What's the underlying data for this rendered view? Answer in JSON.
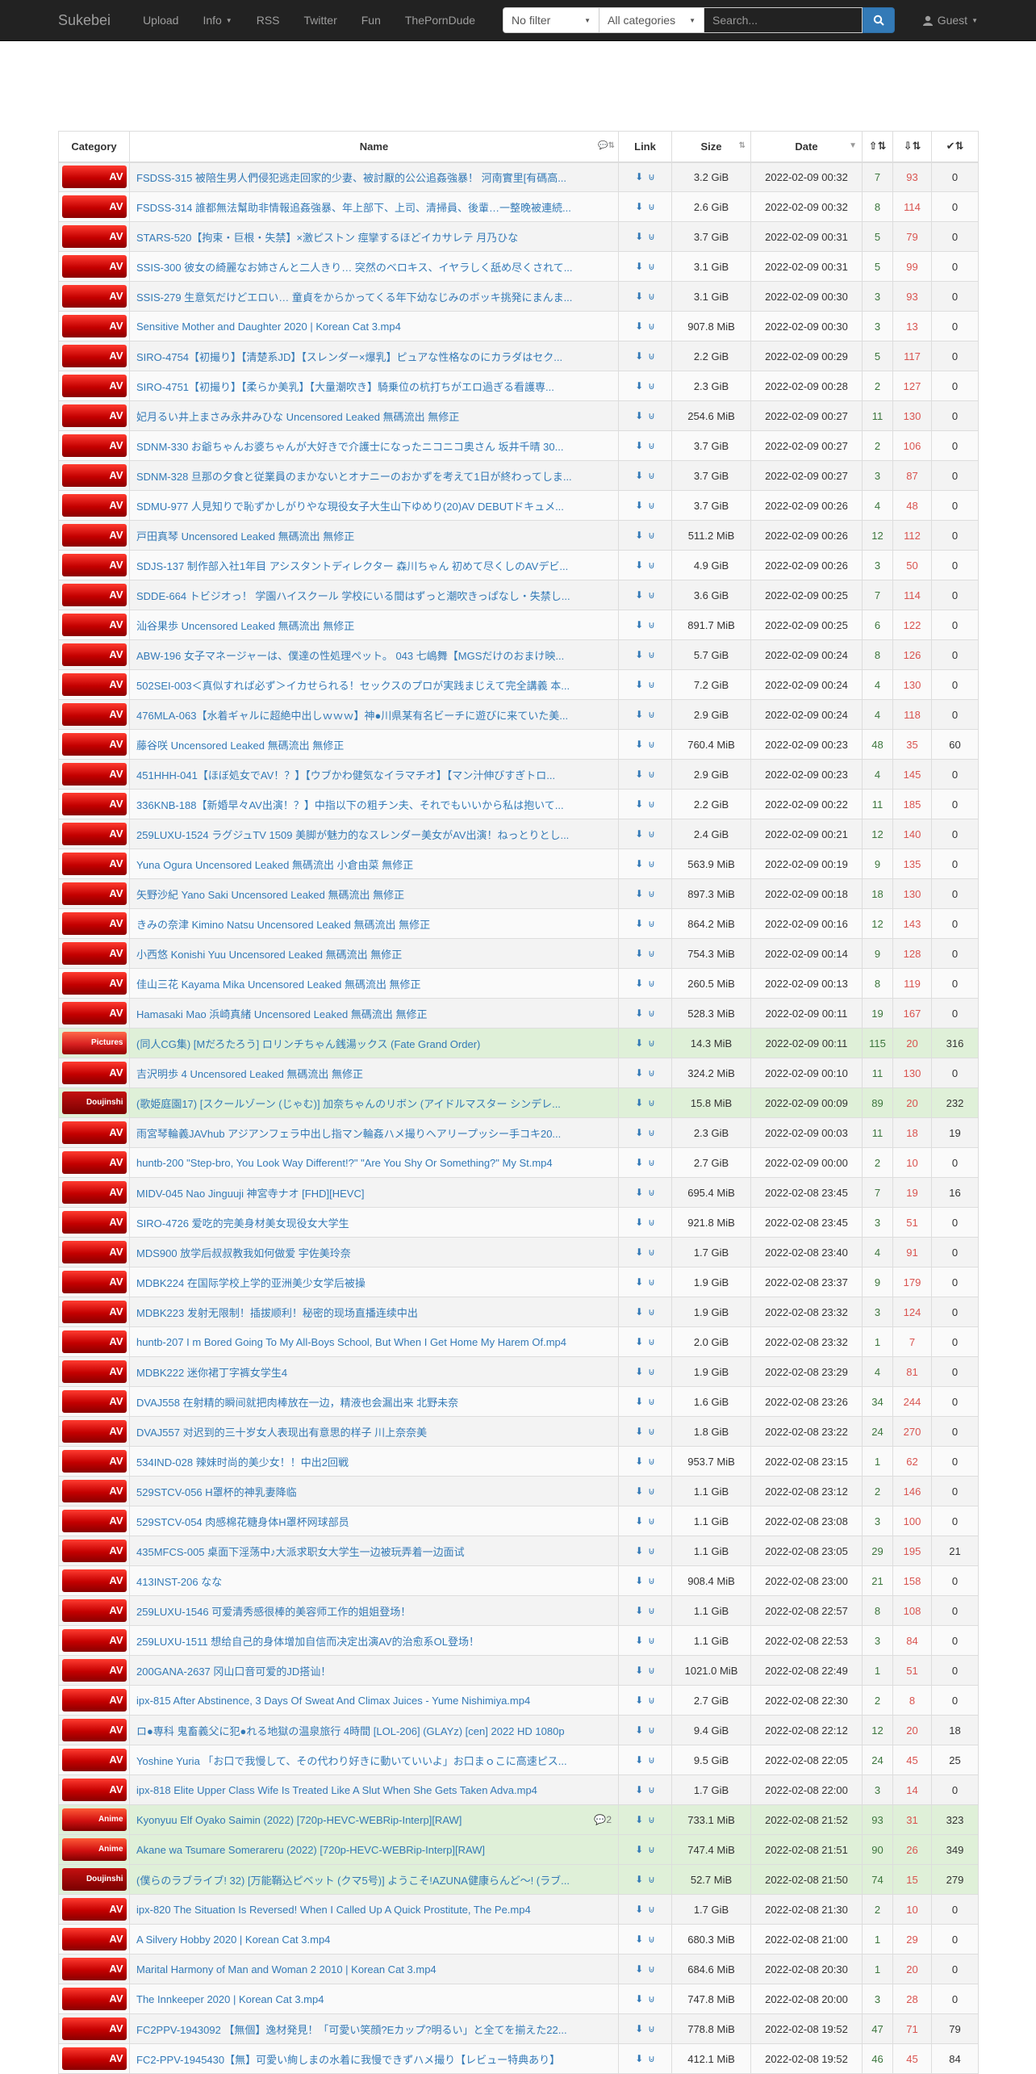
{
  "navbar": {
    "brand": "Sukebei",
    "links": [
      "Upload",
      "Info",
      "RSS",
      "Twitter",
      "Fun",
      "ThePornDude"
    ],
    "filter": "No filter",
    "category": "All categories",
    "search_placeholder": "Search...",
    "user": "Guest"
  },
  "table": {
    "headers": {
      "category": "Category",
      "name": "Name",
      "link": "Link",
      "size": "Size",
      "date": "Date"
    },
    "rows": [
      {
        "cat": "AV",
        "cls": "default",
        "name": "FSDSS-315 被陪生男人們侵犯逃走回家的少妻、被討厭的公公追姦強暴！ 河南實里[有碼高...",
        "size": "3.2 GiB",
        "date": "2022-02-09 00:32",
        "se": "7",
        "le": "93",
        "dl": "0"
      },
      {
        "cat": "AV",
        "cls": "default",
        "name": "FSDSS-314 誰都無法幫助非情報追姦強暴、年上部下、上司、清掃員、後輩…一整晚被連続...",
        "size": "2.6 GiB",
        "date": "2022-02-09 00:32",
        "se": "8",
        "le": "114",
        "dl": "0"
      },
      {
        "cat": "AV",
        "cls": "default",
        "name": "STARS-520【拘束・巨根・失禁】×激ピストン 痙攣するほどイカサレテ 月乃ひな",
        "size": "3.7 GiB",
        "date": "2022-02-09 00:31",
        "se": "5",
        "le": "79",
        "dl": "0"
      },
      {
        "cat": "AV",
        "cls": "default",
        "name": "SSIS-300 彼女の綺麗なお姉さんと二人きり… 突然のベロキス、イヤラしく舐め尽くされて...",
        "size": "3.1 GiB",
        "date": "2022-02-09 00:31",
        "se": "5",
        "le": "99",
        "dl": "0"
      },
      {
        "cat": "AV",
        "cls": "default",
        "name": "SSIS-279 生意気だけどエロい… 童貞をからかってくる年下幼なじみのボッキ挑発にまんま...",
        "size": "3.1 GiB",
        "date": "2022-02-09 00:30",
        "se": "3",
        "le": "93",
        "dl": "0"
      },
      {
        "cat": "AV",
        "cls": "default",
        "name": "Sensitive Mother and Daughter 2020 | Korean Cat 3.mp4",
        "size": "907.8 MiB",
        "date": "2022-02-09 00:30",
        "se": "3",
        "le": "13",
        "dl": "0"
      },
      {
        "cat": "AV",
        "cls": "default",
        "name": "SIRO-4754【初撮り】【清楚系JD】【スレンダー×爆乳】ピュアな性格なのにカラダはセク...",
        "size": "2.2 GiB",
        "date": "2022-02-09 00:29",
        "se": "5",
        "le": "117",
        "dl": "0"
      },
      {
        "cat": "AV",
        "cls": "default",
        "name": "SIRO-4751【初撮り】【柔らか美乳】【大量潮吹き】騎乗位の杭打ちがエロ過ぎる看護専...",
        "size": "2.3 GiB",
        "date": "2022-02-09 00:28",
        "se": "2",
        "le": "127",
        "dl": "0"
      },
      {
        "cat": "AV",
        "cls": "default",
        "name": "妃月るい井上まさみ永井みひな Uncensored Leaked 無碼流出 無修正",
        "size": "254.6 MiB",
        "date": "2022-02-09 00:27",
        "se": "11",
        "le": "130",
        "dl": "0"
      },
      {
        "cat": "AV",
        "cls": "default",
        "name": "SDNM-330 お爺ちゃんお婆ちゃんが大好きで介護士になったニコニコ奥さん 坂井千晴 30...",
        "size": "3.7 GiB",
        "date": "2022-02-09 00:27",
        "se": "2",
        "le": "106",
        "dl": "0"
      },
      {
        "cat": "AV",
        "cls": "default",
        "name": "SDNM-328 旦那の夕食と従業員のまかないとオナニーのおかずを考えて1日が終わってしま...",
        "size": "3.7 GiB",
        "date": "2022-02-09 00:27",
        "se": "3",
        "le": "87",
        "dl": "0"
      },
      {
        "cat": "AV",
        "cls": "default",
        "name": "SDMU-977 人見知りで恥ずかしがりやな現役女子大生山下ゆめり(20)AV DEBUTドキュメ...",
        "size": "3.7 GiB",
        "date": "2022-02-09 00:26",
        "se": "4",
        "le": "48",
        "dl": "0"
      },
      {
        "cat": "AV",
        "cls": "default",
        "name": "戸田真琴 Uncensored Leaked 無碼流出 無修正",
        "size": "511.2 MiB",
        "date": "2022-02-09 00:26",
        "se": "12",
        "le": "112",
        "dl": "0"
      },
      {
        "cat": "AV",
        "cls": "default",
        "name": "SDJS-137 制作部入社1年目 アシスタントディレクター 森川ちゃん 初めて尽くしのAVデビ...",
        "size": "4.9 GiB",
        "date": "2022-02-09 00:26",
        "se": "3",
        "le": "50",
        "dl": "0"
      },
      {
        "cat": "AV",
        "cls": "default",
        "name": "SDDE-664 トビジオっ！ 学園ハイスクール 学校にいる間はずっと潮吹きっぱなし・失禁し...",
        "size": "3.6 GiB",
        "date": "2022-02-09 00:25",
        "se": "7",
        "le": "114",
        "dl": "0"
      },
      {
        "cat": "AV",
        "cls": "default",
        "name": "汕谷果歩 Uncensored Leaked 無碼流出 無修正",
        "size": "891.7 MiB",
        "date": "2022-02-09 00:25",
        "se": "6",
        "le": "122",
        "dl": "0"
      },
      {
        "cat": "AV",
        "cls": "default",
        "name": "ABW-196 女子マネージャーは、僕達の性処理ペット。 043 七嶋舞【MGSだけのおまけ映...",
        "size": "5.7 GiB",
        "date": "2022-02-09 00:24",
        "se": "8",
        "le": "126",
        "dl": "0"
      },
      {
        "cat": "AV",
        "cls": "default",
        "name": "502SEI-003＜真似すれば必ず＞イカせられる！セックスのプロが実践まじえて完全講義 本...",
        "size": "7.2 GiB",
        "date": "2022-02-09 00:24",
        "se": "4",
        "le": "130",
        "dl": "0"
      },
      {
        "cat": "AV",
        "cls": "default",
        "name": "476MLA-063【水着ギャルに超絶中出しｗｗｗ】神●川県某有名ビーチに遊びに来ていた美...",
        "size": "2.9 GiB",
        "date": "2022-02-09 00:24",
        "se": "4",
        "le": "118",
        "dl": "0"
      },
      {
        "cat": "AV",
        "cls": "default",
        "name": "藤谷咲 Uncensored Leaked 無碼流出 無修正",
        "size": "760.4 MiB",
        "date": "2022-02-09 00:23",
        "se": "48",
        "le": "35",
        "dl": "60"
      },
      {
        "cat": "AV",
        "cls": "default",
        "name": "451HHH-041【ほぼ処女でAV！？】【ウブかわ健気なイラマチオ】【マン汁伸びすぎトロ...",
        "size": "2.9 GiB",
        "date": "2022-02-09 00:23",
        "se": "4",
        "le": "145",
        "dl": "0"
      },
      {
        "cat": "AV",
        "cls": "default",
        "name": "336KNB-188【新婚早々AV出演！？】中指以下の粗チン夫、それでもいいから私は抱いて...",
        "size": "2.2 GiB",
        "date": "2022-02-09 00:22",
        "se": "11",
        "le": "185",
        "dl": "0"
      },
      {
        "cat": "AV",
        "cls": "default",
        "name": "259LUXU-1524 ラグジュTV 1509 美脚が魅力的なスレンダー美女がAV出演！ねっとりとし...",
        "size": "2.4 GiB",
        "date": "2022-02-09 00:21",
        "se": "12",
        "le": "140",
        "dl": "0"
      },
      {
        "cat": "AV",
        "cls": "default",
        "name": "Yuna Ogura Uncensored Leaked 無碼流出 小倉由菜 無修正",
        "size": "563.9 MiB",
        "date": "2022-02-09 00:19",
        "se": "9",
        "le": "135",
        "dl": "0"
      },
      {
        "cat": "AV",
        "cls": "default",
        "name": "矢野沙紀 Yano Saki Uncensored Leaked 無碼流出 無修正",
        "size": "897.3 MiB",
        "date": "2022-02-09 00:18",
        "se": "18",
        "le": "130",
        "dl": "0"
      },
      {
        "cat": "AV",
        "cls": "default",
        "name": "きみの奈津 Kimino Natsu Uncensored Leaked 無碼流出 無修正",
        "size": "864.2 MiB",
        "date": "2022-02-09 00:16",
        "se": "12",
        "le": "143",
        "dl": "0"
      },
      {
        "cat": "AV",
        "cls": "default",
        "name": "小西悠 Konishi Yuu Uncensored Leaked 無碼流出 無修正",
        "size": "754.3 MiB",
        "date": "2022-02-09 00:14",
        "se": "9",
        "le": "128",
        "dl": "0"
      },
      {
        "cat": "AV",
        "cls": "default",
        "name": "佳山三花 Kayama Mika Uncensored Leaked 無碼流出 無修正",
        "size": "260.5 MiB",
        "date": "2022-02-09 00:13",
        "se": "8",
        "le": "119",
        "dl": "0"
      },
      {
        "cat": "AV",
        "cls": "default",
        "name": "Hamasaki Mao 浜崎真緒 Uncensored Leaked 無碼流出 無修正",
        "size": "528.3 MiB",
        "date": "2022-02-09 00:11",
        "se": "19",
        "le": "167",
        "dl": "0"
      },
      {
        "cat": "Pictures",
        "cls": "success",
        "name": "(同人CG集) [Mだろたろう] ロリンチちゃん銭湯ックス (Fate Grand Order)",
        "size": "14.3 MiB",
        "date": "2022-02-09 00:11",
        "se": "115",
        "le": "20",
        "dl": "316"
      },
      {
        "cat": "AV",
        "cls": "default",
        "name": "吉沢明歩 4 Uncensored Leaked 無碼流出 無修正",
        "size": "324.2 MiB",
        "date": "2022-02-09 00:10",
        "se": "11",
        "le": "130",
        "dl": "0"
      },
      {
        "cat": "Doujinshi",
        "cls": "success",
        "name": "(歌姫庭園17) [スクールゾーン (じゃむ)] 加奈ちゃんのリボン (アイドルマスター シンデレ...",
        "size": "15.8 MiB",
        "date": "2022-02-09 00:09",
        "se": "89",
        "le": "20",
        "dl": "232"
      },
      {
        "cat": "AV",
        "cls": "default",
        "name": "雨宮琴輪義JAVhub アジアンフェラ中出し指マン輪姦ハメ撮りヘアリープッシー手コキ20...",
        "size": "2.3 GiB",
        "date": "2022-02-09 00:03",
        "se": "11",
        "le": "18",
        "dl": "19"
      },
      {
        "cat": "AV",
        "cls": "default",
        "name": "huntb-200 \"Step-bro, You Look Way Different!?\" \"Are You Shy Or Something?\" My St.mp4",
        "size": "2.7 GiB",
        "date": "2022-02-09 00:00",
        "se": "2",
        "le": "10",
        "dl": "0"
      },
      {
        "cat": "AV",
        "cls": "default",
        "name": "MIDV-045 Nao Jinguuji 神宮寺ナオ [FHD][HEVC]",
        "size": "695.4 MiB",
        "date": "2022-02-08 23:45",
        "se": "7",
        "le": "19",
        "dl": "16"
      },
      {
        "cat": "AV",
        "cls": "default",
        "name": "SIRO-4726 爱吃的完美身材美女现役女大学生",
        "size": "921.8 MiB",
        "date": "2022-02-08 23:45",
        "se": "3",
        "le": "51",
        "dl": "0"
      },
      {
        "cat": "AV",
        "cls": "default",
        "name": "MDS900 放学后叔叔教我如何做爱 宇佐美玲奈",
        "size": "1.7 GiB",
        "date": "2022-02-08 23:40",
        "se": "4",
        "le": "91",
        "dl": "0"
      },
      {
        "cat": "AV",
        "cls": "default",
        "name": "MDBK224 在国际学校上学的亚洲美少女学后被操",
        "size": "1.9 GiB",
        "date": "2022-02-08 23:37",
        "se": "9",
        "le": "179",
        "dl": "0"
      },
      {
        "cat": "AV",
        "cls": "default",
        "name": "MDBK223 发射无限制！插拔顺利！秘密的现场直播连续中出",
        "size": "1.9 GiB",
        "date": "2022-02-08 23:32",
        "se": "3",
        "le": "124",
        "dl": "0"
      },
      {
        "cat": "AV",
        "cls": "default",
        "name": "huntb-207 I m Bored Going To My All-Boys School, But When I Get Home My Harem Of.mp4",
        "size": "2.0 GiB",
        "date": "2022-02-08 23:32",
        "se": "1",
        "le": "7",
        "dl": "0"
      },
      {
        "cat": "AV",
        "cls": "default",
        "name": "MDBK222 迷你裙丁字裤女学生4",
        "size": "1.9 GiB",
        "date": "2022-02-08 23:29",
        "se": "4",
        "le": "81",
        "dl": "0"
      },
      {
        "cat": "AV",
        "cls": "default",
        "name": "DVAJ558 在射精的瞬间就把肉棒放在一边，精液也会漏出来 北野未奈",
        "size": "1.6 GiB",
        "date": "2022-02-08 23:26",
        "se": "34",
        "le": "244",
        "dl": "0"
      },
      {
        "cat": "AV",
        "cls": "default",
        "name": "DVAJ557 对迟到的三十岁女人表现出有意思的样子 川上奈奈美",
        "size": "1.8 GiB",
        "date": "2022-02-08 23:22",
        "se": "24",
        "le": "270",
        "dl": "0"
      },
      {
        "cat": "AV",
        "cls": "default",
        "name": "534IND-028 辣妹时尚的美少女！！中出2回戦",
        "size": "953.7 MiB",
        "date": "2022-02-08 23:15",
        "se": "1",
        "le": "62",
        "dl": "0"
      },
      {
        "cat": "AV",
        "cls": "default",
        "name": "529STCV-056 H罩杯的神乳妻降临",
        "size": "1.1 GiB",
        "date": "2022-02-08 23:12",
        "se": "2",
        "le": "146",
        "dl": "0"
      },
      {
        "cat": "AV",
        "cls": "default",
        "name": "529STCV-054 肉感棉花糖身体H罩杯网球部员",
        "size": "1.1 GiB",
        "date": "2022-02-08 23:08",
        "se": "3",
        "le": "100",
        "dl": "0"
      },
      {
        "cat": "AV",
        "cls": "default",
        "name": "435MFCS-005 桌面下淫荡中♪大派求职女大学生一边被玩弄着一边面试",
        "size": "1.1 GiB",
        "date": "2022-02-08 23:05",
        "se": "29",
        "le": "195",
        "dl": "21"
      },
      {
        "cat": "AV",
        "cls": "default",
        "name": "413INST-206 なな",
        "size": "908.4 MiB",
        "date": "2022-02-08 23:00",
        "se": "21",
        "le": "158",
        "dl": "0"
      },
      {
        "cat": "AV",
        "cls": "default",
        "name": "259LUXU-1546 可爱清秀感很棒的美容师工作的姐姐登场！",
        "size": "1.1 GiB",
        "date": "2022-02-08 22:57",
        "se": "8",
        "le": "108",
        "dl": "0"
      },
      {
        "cat": "AV",
        "cls": "default",
        "name": "259LUXU-1511 想给自己的身体增加自信而决定出演AV的治愈系OL登场！",
        "size": "1.1 GiB",
        "date": "2022-02-08 22:53",
        "se": "3",
        "le": "84",
        "dl": "0"
      },
      {
        "cat": "AV",
        "cls": "default",
        "name": "200GANA-2637 冈山口音可爱的JD搭讪！",
        "size": "1021.0 MiB",
        "date": "2022-02-08 22:49",
        "se": "1",
        "le": "51",
        "dl": "0"
      },
      {
        "cat": "AV",
        "cls": "default",
        "name": "ipx-815 After Abstinence, 3 Days Of Sweat And Climax Juices - Yume Nishimiya.mp4",
        "size": "2.7 GiB",
        "date": "2022-02-08 22:30",
        "se": "2",
        "le": "8",
        "dl": "0"
      },
      {
        "cat": "AV",
        "cls": "default",
        "name": "ロ●専科 鬼畜義父に犯●れる地獄の温泉旅行 4時間 [LOL-206] (GLAYz) [cen] 2022 HD 1080p",
        "size": "9.4 GiB",
        "date": "2022-02-08 22:12",
        "se": "12",
        "le": "20",
        "dl": "18"
      },
      {
        "cat": "AV",
        "cls": "default",
        "name": "Yoshine Yuria 「お口で我慢して、その代わり好きに動いていいよ」お口まｏこに高速ピス...",
        "size": "9.5 GiB",
        "date": "2022-02-08 22:05",
        "se": "24",
        "le": "45",
        "dl": "25"
      },
      {
        "cat": "AV",
        "cls": "default",
        "name": "ipx-818 Elite Upper Class Wife Is Treated Like A Slut When She Gets Taken Adva.mp4",
        "size": "1.7 GiB",
        "date": "2022-02-08 22:00",
        "se": "3",
        "le": "14",
        "dl": "0"
      },
      {
        "cat": "Anime",
        "cls": "success",
        "name": "Kyonyuu Elf Oyako Saimin (2022) [720p-HEVC-WEBRip-Interp][RAW]",
        "comments": "2",
        "size": "733.1 MiB",
        "date": "2022-02-08 21:52",
        "se": "93",
        "le": "31",
        "dl": "323"
      },
      {
        "cat": "Anime",
        "cls": "success",
        "name": "Akane wa Tsumare Somerareru (2022) [720p-HEVC-WEBRip-Interp][RAW]",
        "size": "747.4 MiB",
        "date": "2022-02-08 21:51",
        "se": "90",
        "le": "26",
        "dl": "349"
      },
      {
        "cat": "Doujinshi",
        "cls": "success",
        "name": "(僕らのラブライブ! 32) [万能鞘込ピベット (クマ5号)] ようこそ!AZUNA健康らんど〜! (ラブ...",
        "size": "52.7 MiB",
        "date": "2022-02-08 21:50",
        "se": "74",
        "le": "15",
        "dl": "279"
      },
      {
        "cat": "AV",
        "cls": "default",
        "name": "ipx-820 The Situation Is Reversed! When I Called Up A Quick Prostitute, The Pe.mp4",
        "size": "1.7 GiB",
        "date": "2022-02-08 21:30",
        "se": "2",
        "le": "10",
        "dl": "0"
      },
      {
        "cat": "AV",
        "cls": "default",
        "name": "A Silvery Hobby 2020 | Korean Cat 3.mp4",
        "size": "680.3 MiB",
        "date": "2022-02-08 21:00",
        "se": "1",
        "le": "29",
        "dl": "0"
      },
      {
        "cat": "AV",
        "cls": "default",
        "name": "Marital Harmony of Man and Woman 2 2010 | Korean Cat 3.mp4",
        "size": "684.6 MiB",
        "date": "2022-02-08 20:30",
        "se": "1",
        "le": "20",
        "dl": "0"
      },
      {
        "cat": "AV",
        "cls": "default",
        "name": "The Innkeeper 2020 | Korean Cat 3.mp4",
        "size": "747.8 MiB",
        "date": "2022-02-08 20:00",
        "se": "3",
        "le": "28",
        "dl": "0"
      },
      {
        "cat": "AV",
        "cls": "default",
        "name": "FC2PPV-1943092 【無個】逸材発見！「可愛い笑顔?Eカップ?明るい」と全てを揃えた22...",
        "size": "778.8 MiB",
        "date": "2022-02-08 19:52",
        "se": "47",
        "le": "71",
        "dl": "79"
      },
      {
        "cat": "AV",
        "cls": "default",
        "name": "FC2-PPV-1945430【無】可愛い絢しまの水着に我慢できずハメ撮り【レビュー特典あり】",
        "size": "412.1 MiB",
        "date": "2022-02-08 19:52",
        "se": "46",
        "le": "45",
        "dl": "84"
      }
    ]
  }
}
